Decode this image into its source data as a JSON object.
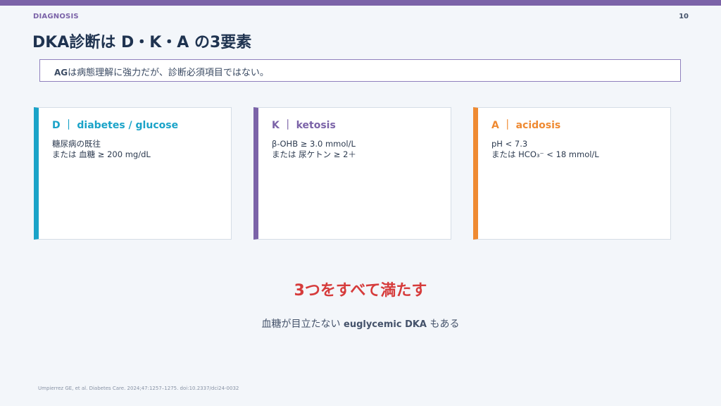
{
  "slide": {
    "section": "DIAGNOSIS",
    "page_number": "10",
    "title": "DKA診断は D・K・A の3要素",
    "note": {
      "ag": "AG",
      "text": "は病態理解に強力だが、診断必須項目ではない。"
    },
    "cards": [
      {
        "title": "D ｜ diabetes / glucose",
        "lines": [
          "糖尿病の既往",
          "または 血糖 ≥ 200 mg/dL"
        ],
        "color": "#1aa3c8"
      },
      {
        "title": "K ｜ ketosis",
        "lines": [
          "β-OHB ≥ 3.0 mmol/L",
          "または 尿ケトン ≥ 2＋"
        ],
        "color": "#7b63a8"
      },
      {
        "title": "A ｜ acidosis",
        "lines": [
          "pH < 7.3",
          "または HCO₃⁻ < 18 mmol/L"
        ],
        "color": "#ef8a32"
      }
    ],
    "headline": "3つをすべて満たす",
    "subline": {
      "before": "血糖が目立たない ",
      "en": "euglycemic DKA",
      "after": " もある"
    },
    "reference": "Umpierrez GE, et al. Diabetes Care. 2024;47:1257–1275. doi:10.2337/dci24-0032",
    "colors": {
      "accent_purple": "#7b63a8",
      "d_blue": "#1aa3c8",
      "a_orange": "#ef8a32",
      "headline_red": "#d63b3b"
    }
  }
}
